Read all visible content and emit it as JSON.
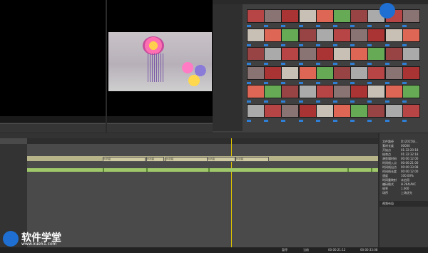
{
  "app": {
    "title": "软件学堂",
    "watermark_url": "www.xue51.com"
  },
  "timeline": {
    "video_clips": [
      {
        "label": "V1片段"
      },
      {
        "label": "V1片段"
      },
      {
        "label": "V1片段"
      },
      {
        "label": "V1片段"
      },
      {
        "label": "V1片段"
      }
    ],
    "audio_clips": [
      {
        "label": "A"
      },
      {
        "label": "A"
      },
      {
        "label": "A"
      },
      {
        "label": "A"
      },
      {
        "label": "A"
      }
    ]
  },
  "properties": {
    "rows": [
      {
        "k": "文件路径",
        "v": "D:\\2015\\8..."
      },
      {
        "k": "素材长度",
        "v": "00000"
      },
      {
        "k": "开始点",
        "v": "01:32:20:18"
      },
      {
        "k": "结束点",
        "v": "01:32:32:18"
      },
      {
        "k": "源剪辑时码",
        "v": "00:00:12:00"
      },
      {
        "k": "时间线入点",
        "v": "00:00:21:00"
      },
      {
        "k": "时间线出点",
        "v": "00:00:33:08"
      },
      {
        "k": "时间线长度",
        "v": "00:00:12:00"
      },
      {
        "k": "速度",
        "v": "100.00%"
      },
      {
        "k": "时间重映射",
        "v": "未启用"
      },
      {
        "k": "编码格式",
        "v": "H.264/AVC"
      },
      {
        "k": "帧率",
        "v": "1.000"
      },
      {
        "k": "场序",
        "v": "上场优先"
      }
    ],
    "effect_item": "视频布局"
  },
  "status": {
    "items": [
      "暂停",
      "当前",
      "00:00:21:12",
      "00:00:33:08"
    ]
  },
  "colors": {
    "accent": "#2f7fd6",
    "video_track": "#b8b48a",
    "audio_track": "#9fc86a"
  }
}
